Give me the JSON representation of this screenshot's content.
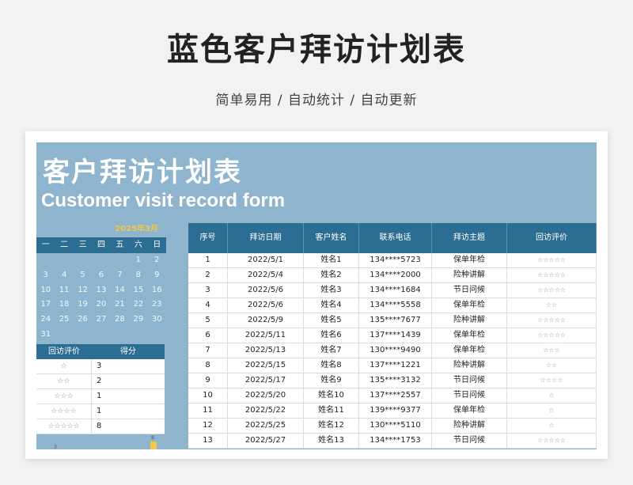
{
  "page": {
    "title": "蓝色客户拜访计划表",
    "subtitle": "简单易用 / 自动统计 / 自动更新"
  },
  "banner": {
    "title_cn": "客户拜访计划表",
    "title_en": "Customer visit record form"
  },
  "calendar": {
    "month_label": "2025年3月",
    "weekdays": [
      "一",
      "二",
      "三",
      "四",
      "五",
      "六",
      "日"
    ],
    "cells": [
      "",
      "",
      "",
      "",
      "",
      "1",
      "2",
      "3",
      "4",
      "5",
      "6",
      "7",
      "8",
      "9",
      "10",
      "11",
      "12",
      "13",
      "14",
      "15",
      "16",
      "17",
      "18",
      "19",
      "20",
      "21",
      "22",
      "23",
      "24",
      "25",
      "26",
      "27",
      "28",
      "29",
      "30",
      "31",
      "",
      "",
      "",
      "",
      "",
      ""
    ]
  },
  "rating_summary": {
    "headers": [
      "回访评价",
      "得分"
    ],
    "rows": [
      {
        "stars": "☆",
        "score": "3"
      },
      {
        "stars": "☆☆",
        "score": "2"
      },
      {
        "stars": "☆☆☆",
        "score": "1"
      },
      {
        "stars": "☆☆☆☆",
        "score": "1"
      },
      {
        "stars": "☆☆☆☆☆",
        "score": "8"
      }
    ],
    "chart_bar_label": "8",
    "chart_dot_label": "3"
  },
  "table": {
    "headers": [
      "序号",
      "拜访日期",
      "客户姓名",
      "联系电话",
      "拜访主题",
      "回访评价"
    ],
    "rows": [
      [
        "1",
        "2022/5/1",
        "姓名1",
        "134****5723",
        "保单年检",
        "☆☆☆☆☆"
      ],
      [
        "2",
        "2022/5/4",
        "姓名2",
        "134****2000",
        "险种讲解",
        "☆☆☆☆☆"
      ],
      [
        "3",
        "2022/5/6",
        "姓名3",
        "134****1684",
        "节日问候",
        "☆☆☆☆☆"
      ],
      [
        "4",
        "2022/5/6",
        "姓名4",
        "134****5558",
        "保单年检",
        "☆☆"
      ],
      [
        "5",
        "2022/5/9",
        "姓名5",
        "135****7677",
        "险种讲解",
        "☆☆☆☆☆"
      ],
      [
        "6",
        "2022/5/11",
        "姓名6",
        "137****1439",
        "保单年检",
        "☆☆☆☆☆"
      ],
      [
        "7",
        "2022/5/13",
        "姓名7",
        "130****9490",
        "保单年检",
        "☆☆☆"
      ],
      [
        "8",
        "2022/5/15",
        "姓名8",
        "137****1221",
        "险种讲解",
        "☆☆"
      ],
      [
        "9",
        "2022/5/17",
        "姓名9",
        "135****3132",
        "节日问候",
        "☆☆☆☆"
      ],
      [
        "10",
        "2022/5/20",
        "姓名10",
        "137****2557",
        "节日问候",
        "☆"
      ],
      [
        "11",
        "2022/5/22",
        "姓名11",
        "139****9377",
        "保单年检",
        "☆"
      ],
      [
        "12",
        "2022/5/25",
        "姓名12",
        "130****5110",
        "险种讲解",
        "☆"
      ],
      [
        "13",
        "2022/5/27",
        "姓名13",
        "134****1753",
        "节日问候",
        "☆☆☆☆☆"
      ]
    ]
  }
}
